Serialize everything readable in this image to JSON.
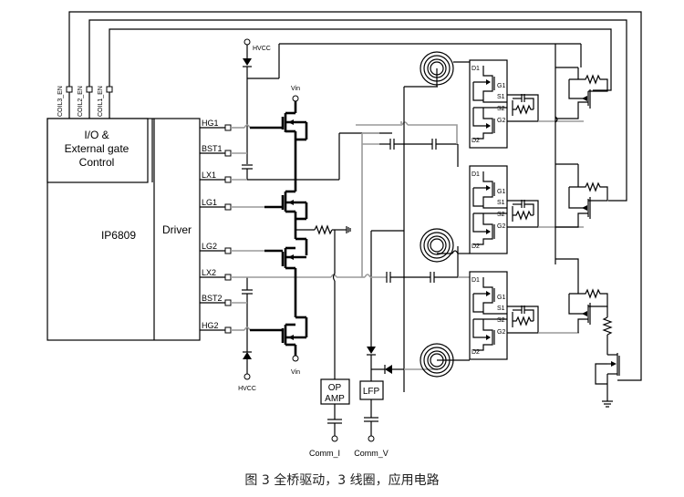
{
  "diagram": {
    "ic_name": "IP6809",
    "io_block_label_lines": [
      "I/O &",
      "External gate",
      "Control"
    ],
    "driver_label": "Driver",
    "coil_enable_pins": [
      "COIL3_EN",
      "COIL2_EN",
      "COIL1_EN"
    ],
    "driver_pins": [
      "HG1",
      "BST1",
      "LX1",
      "LG1",
      "LG2",
      "LX2",
      "BST2",
      "HG2"
    ],
    "supply_labels": {
      "hvcc_top": "HVCC",
      "hvcc_bottom": "HVCC",
      "vin_top": "Vin",
      "vin_bottom": "Vin"
    },
    "switch_block_pins": [
      "D1",
      "G1",
      "S1",
      "S2",
      "G2",
      "D2"
    ],
    "coil_count": 3,
    "op_amp_label_lines": [
      "OP",
      "AMP"
    ],
    "lfp_label": "LFP",
    "outputs": {
      "current": "Comm_I",
      "voltage": "Comm_V"
    }
  },
  "caption": "图 3 全桥驱动，3 线圈，应用电路"
}
